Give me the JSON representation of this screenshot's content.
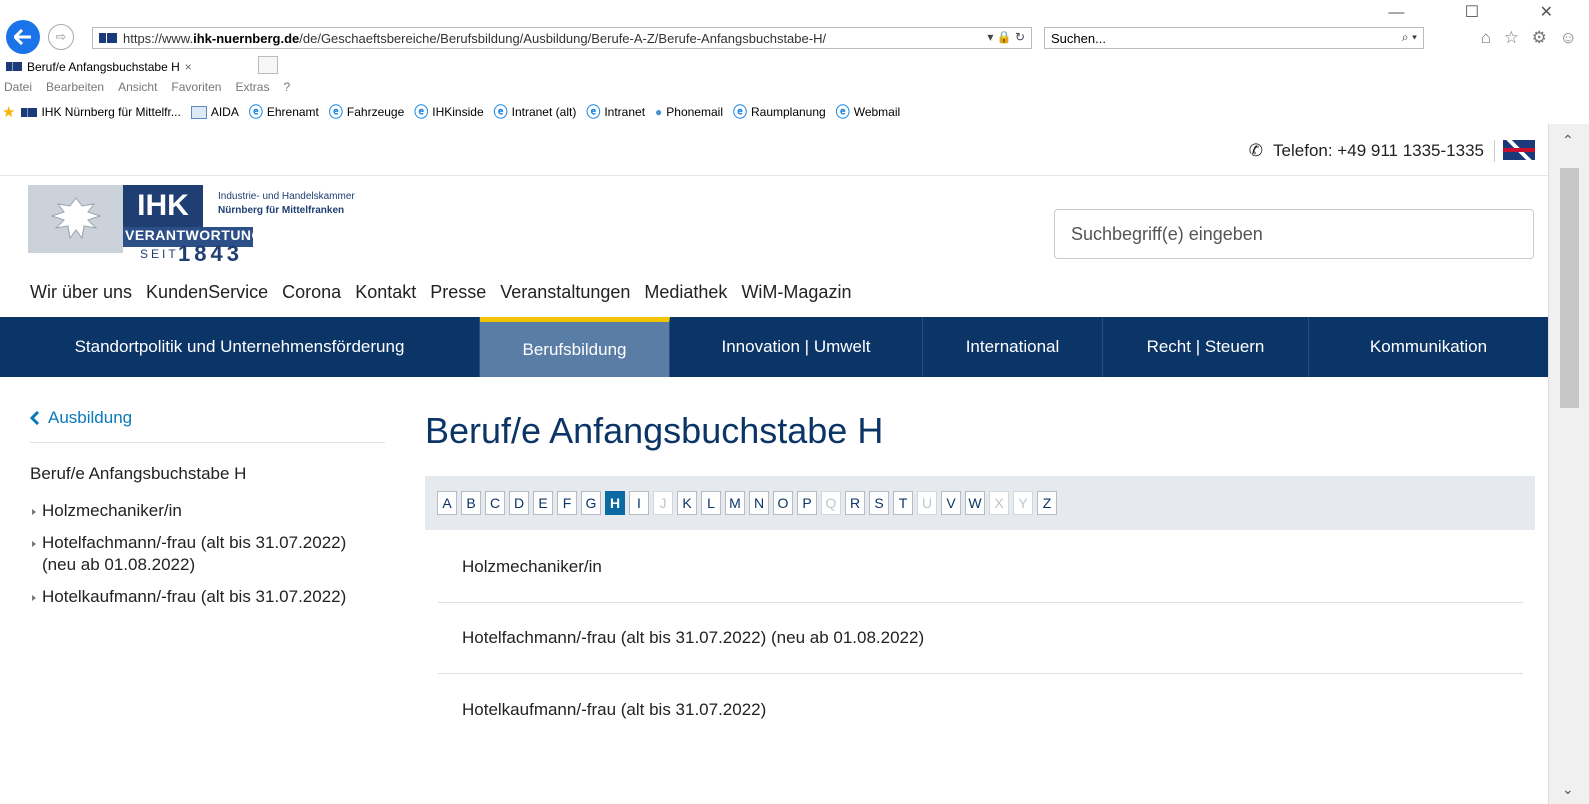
{
  "browser": {
    "url_prefix": "https://www.",
    "url_domain": "ihk-nuernberg.de",
    "url_path": "/de/Geschaeftsbereiche/Berufsbildung/Ausbildung/Berufe-A-Z/Berufe-Anfangsbuchstabe-H/",
    "url_tail": "▾ 🔒 ↻",
    "search_placeholder": "Suchen...",
    "search_icon": "⌕ ▾",
    "tab_title": "Beruf/e Anfangsbuchstabe H",
    "tab_close": "×",
    "window_controls": "— ☐ ✕",
    "tool_icons": "⌂ ☆ ⚙ ☺",
    "menu": [
      "Datei",
      "Bearbeiten",
      "Ansicht",
      "Favoriten",
      "Extras",
      "?"
    ],
    "favorites": [
      {
        "label": "IHK Nürnberg für Mittelfr...",
        "icon": "ihk-flag-icon"
      },
      {
        "label": "AIDA",
        "icon": "aida-icon"
      },
      {
        "label": "Ehrenamt",
        "icon": "ie-icon"
      },
      {
        "label": "Fahrzeuge",
        "icon": "ie-icon"
      },
      {
        "label": "IHKinside",
        "icon": "ie-icon"
      },
      {
        "label": "Intranet (alt)",
        "icon": "ie-icon"
      },
      {
        "label": "Intranet",
        "icon": "ie-icon"
      },
      {
        "label": "Phonemail",
        "icon": "globe-icon"
      },
      {
        "label": "Raumplanung",
        "icon": "ie-icon"
      },
      {
        "label": "Webmail",
        "icon": "ie-icon"
      }
    ]
  },
  "header": {
    "phone": "Telefon: +49 911 1335-1335",
    "phone_icon": "✆",
    "logo": {
      "ihk": "IHK",
      "verantwortung": "VERANTWORTUNG",
      "seit": "SEIT",
      "year": "1843",
      "line1": "Industrie- und Handelskammer",
      "line2": "Nürnberg für Mittelfranken"
    },
    "search_placeholder": "Suchbegriff(e) eingeben"
  },
  "meta_nav": [
    "Wir über uns",
    "KundenService",
    "Corona",
    "Kontakt",
    "Presse",
    "Veranstaltungen",
    "Mediathek",
    "WiM-Magazin"
  ],
  "main_nav": [
    {
      "label": "Standortpolitik und Unternehmensförderung",
      "active": false
    },
    {
      "label": "Berufsbildung",
      "active": true
    },
    {
      "label": "Innovation | Umwelt",
      "active": false
    },
    {
      "label": "International",
      "active": false
    },
    {
      "label": "Recht | Steuern",
      "active": false
    },
    {
      "label": "Kommunikation",
      "active": false
    }
  ],
  "sidebar": {
    "back_label": "Ausbildung",
    "title": "Beruf/e Anfangsbuchstabe H",
    "items": [
      "Holzmechaniker/in",
      "Hotelfachmann/-frau (alt bis 31.07.2022) (neu ab 01.08.2022)",
      "Hotelkaufmann/-frau (alt bis 31.07.2022)"
    ]
  },
  "main": {
    "title": "Beruf/e Anfangsbuchstabe H",
    "letters": [
      {
        "l": "A",
        "state": "normal"
      },
      {
        "l": "B",
        "state": "normal"
      },
      {
        "l": "C",
        "state": "normal"
      },
      {
        "l": "D",
        "state": "normal"
      },
      {
        "l": "E",
        "state": "normal"
      },
      {
        "l": "F",
        "state": "normal"
      },
      {
        "l": "G",
        "state": "normal"
      },
      {
        "l": "H",
        "state": "active"
      },
      {
        "l": "I",
        "state": "normal"
      },
      {
        "l": "J",
        "state": "disabled"
      },
      {
        "l": "K",
        "state": "normal"
      },
      {
        "l": "L",
        "state": "normal"
      },
      {
        "l": "M",
        "state": "normal"
      },
      {
        "l": "N",
        "state": "normal"
      },
      {
        "l": "O",
        "state": "normal"
      },
      {
        "l": "P",
        "state": "normal"
      },
      {
        "l": "Q",
        "state": "disabled"
      },
      {
        "l": "R",
        "state": "normal"
      },
      {
        "l": "S",
        "state": "normal"
      },
      {
        "l": "T",
        "state": "normal"
      },
      {
        "l": "U",
        "state": "disabled"
      },
      {
        "l": "V",
        "state": "normal"
      },
      {
        "l": "W",
        "state": "normal"
      },
      {
        "l": "X",
        "state": "disabled"
      },
      {
        "l": "Y",
        "state": "disabled"
      },
      {
        "l": "Z",
        "state": "normal"
      }
    ],
    "results": [
      "Holzmechaniker/in",
      "Hotelfachmann/-frau (alt bis 31.07.2022) (neu ab 01.08.2022)",
      "Hotelkaufmann/-frau (alt bis 31.07.2022)"
    ]
  },
  "colors": {
    "nav_bg": "#0b3467",
    "nav_active": "#5a7da6",
    "accent_yellow": "#f4c300",
    "link": "#0a79b8"
  }
}
